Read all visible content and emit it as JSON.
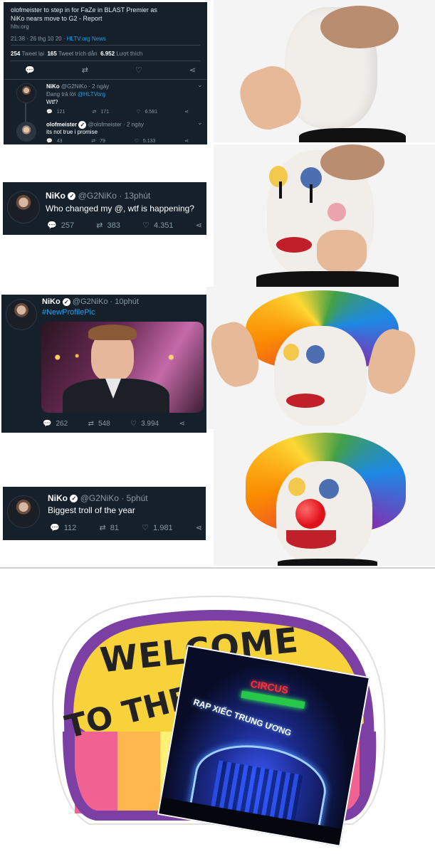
{
  "tweet1": {
    "headline_1": "olofmeister to step in for FaZe in BLAST Premier as",
    "headline_2": "NiKo nears move to G2 - Report",
    "domain": "hltv.org",
    "meta": "21:38 · 26 thg 10 20 · ",
    "source": "HLTV.org News",
    "retweets_count": "254",
    "retweets_label": "Tweet lại",
    "quotes_count": "165",
    "quotes_label": "Tweet trích dẫn",
    "likes_count": "6.952",
    "likes_label": "Lượt thích",
    "reply1": {
      "name": "NiKo",
      "handle": "@G2NiKo · 2 ngày",
      "replying": "Đang trả lời ",
      "replying_to": "@HLTVorg",
      "text": "Wtf?",
      "replies": "121",
      "retweets": "171",
      "likes": "6.581"
    },
    "reply2": {
      "name": "olofmeister",
      "handle": "@olofmeister · 2 ngày",
      "text": "its not true i promise",
      "replies": "43",
      "retweets": "79",
      "likes": "5.133"
    }
  },
  "tweet2": {
    "name": "NiKo",
    "handle": "@G2NiKo · 13phút",
    "text": "Who changed my @, wtf is happening?",
    "replies": "257",
    "retweets": "383",
    "likes": "4.351"
  },
  "tweet3": {
    "name": "NiKo",
    "handle": "@G2NiKo · 10phút",
    "hashtag": "#NewProfilePic",
    "replies": "262",
    "retweets": "548",
    "likes": "3.994"
  },
  "tweet4": {
    "name": "NiKo",
    "handle": "@G2NiKo · 5phút",
    "text": "Biggest troll of the year",
    "replies": "112",
    "retweets": "81",
    "likes": "1.981"
  },
  "sticker": {
    "line1": "WELCOME",
    "line2": "TO THE",
    "photo_sign_top": "CIRCUS",
    "photo_sign_main": "RẠP XIẾC TRUNG ƯƠNG"
  },
  "colors": {
    "tweet_bg": "#15202b",
    "tweet_muted": "#8899a6",
    "tweet_link": "#1da1f2",
    "sticker_yellow": "#f7d23a",
    "sticker_purple": "#7c3fa4"
  },
  "icons": [
    "reply-icon",
    "retweet-icon",
    "like-icon",
    "share-icon",
    "verified-icon",
    "more-icon"
  ]
}
